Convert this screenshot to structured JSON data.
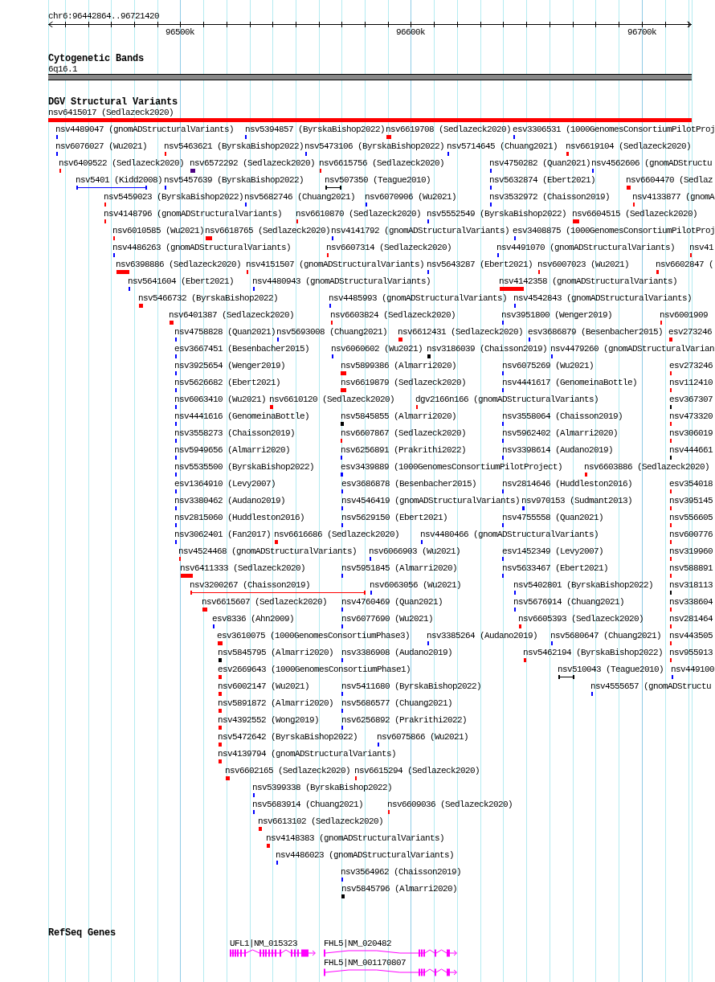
{
  "ruler": {
    "position": "chr6:96442864..96721420",
    "ticks": [
      "96500k",
      "96600k",
      "96700k"
    ]
  },
  "cytogenetic_bands": {
    "title": "Cytogenetic Bands",
    "band_label": "6q16.1"
  },
  "dgv_structural_variants": {
    "title": "DGV Structural Variants",
    "rows": [
      {
        "features": [
          {
            "label": "nsv6415017 (Sedlazeck2020)",
            "color": "#ff0000",
            "kind": "block"
          }
        ]
      },
      {
        "features": [
          {
            "label": "nsv4489047 (gnomADStructuralVariants)",
            "color": "#0000ff",
            "kind": "block"
          },
          {
            "label": "nsv5394857 (ByrskaBishop2022)",
            "color": "#0000ff",
            "kind": "block"
          },
          {
            "label": "nsv6619708 (Sedlazeck2020)",
            "color": "#ff0000",
            "kind": "block"
          },
          {
            "label": "esv3306531 (1000GenomesConsortiumPilotProj",
            "color": "#0000ff",
            "kind": "block"
          }
        ]
      },
      {
        "features": [
          {
            "label": "nsv6076027 (Wu2021)",
            "color": "#0000ff",
            "kind": "block"
          },
          {
            "label": "nsv5463621 (ByrskaBishop2022)",
            "color": "#ff0000",
            "kind": "block"
          },
          {
            "label": "nsv5473106 (ByrskaBishop2022)",
            "color": "#0000ff",
            "kind": "block"
          },
          {
            "label": "nsv5714645 (Chuang2021)",
            "color": "#0000ff",
            "kind": "block"
          },
          {
            "label": "nsv6619104 (Sedlazeck2020)",
            "color": "#ff0000",
            "kind": "block"
          }
        ]
      },
      {
        "features": [
          {
            "label": "nsv6409522 (Sedlazeck2020)",
            "color": "#ff0000",
            "kind": "block"
          },
          {
            "label": "nsv6572292 (Sedlazeck2020)",
            "color": "#4b0082",
            "kind": "block"
          },
          {
            "label": "nsv6615756 (Sedlazeck2020)",
            "color": "#ff0000",
            "kind": "block"
          },
          {
            "label": "nsv4750282 (Quan2021)",
            "color": "#0000ff",
            "kind": "block"
          },
          {
            "label": "nsv4562606 (gnomADStructu",
            "color": "#0000ff",
            "kind": "block"
          }
        ]
      },
      {
        "features": [
          {
            "label": "nsv5401 (Kidd2008)",
            "color": "#0000ff",
            "kind": "span"
          },
          {
            "label": "nsv5457639 (ByrskaBishop2022)",
            "color": "#0000ff",
            "kind": "block"
          },
          {
            "label": "nsv507350 (Teague2010)",
            "color": "#000000",
            "kind": "span"
          },
          {
            "label": "nsv5632874 (Ebert2021)",
            "color": "#0000ff",
            "kind": "block"
          },
          {
            "label": "nsv6604470 (Sedlaz",
            "color": "#ff0000",
            "kind": "block"
          }
        ]
      },
      {
        "features": [
          {
            "label": "nsv5459023 (ByrskaBishop2022)",
            "color": "#ff0000",
            "kind": "block"
          },
          {
            "label": "nsv5682746 (Chuang2021)",
            "color": "#0000ff",
            "kind": "block"
          },
          {
            "label": "nsv6070906 (Wu2021)",
            "color": "#0000ff",
            "kind": "block"
          },
          {
            "label": "nsv3532972 (Chaisson2019)",
            "color": "#0000ff",
            "kind": "block"
          },
          {
            "label": "nsv4133877 (gnomA",
            "color": "#ff0000",
            "kind": "block"
          }
        ]
      },
      {
        "features": [
          {
            "label": "nsv4148796 (gnomADStructuralVariants)",
            "color": "#ff0000",
            "kind": "block"
          },
          {
            "label": "nsv6610870 (Sedlazeck2020)",
            "color": "#ff0000",
            "kind": "block"
          },
          {
            "label": "nsv5552549 (ByrskaBishop2022)",
            "color": "#0000ff",
            "kind": "block"
          },
          {
            "label": "nsv6604515 (Sedlazeck2020)",
            "color": "#ff0000",
            "kind": "block"
          }
        ]
      },
      {
        "features": [
          {
            "label": "nsv6010585 (Wu2021)",
            "color": "#ff0000",
            "kind": "block"
          },
          {
            "label": "nsv6618765 (Sedlazeck2020)",
            "color": "#ff0000",
            "kind": "block"
          },
          {
            "label": "nsv4141792 (gnomADStructuralVariants)",
            "color": "#0000ff",
            "kind": "block"
          },
          {
            "label": "esv3408875 (1000GenomesConsortiumPilotProj",
            "color": "#0000ff",
            "kind": "block"
          }
        ]
      },
      {
        "features": [
          {
            "label": "nsv4486263 (gnomADStructuralVariants)",
            "color": "#0000ff",
            "kind": "block"
          },
          {
            "label": "nsv6607314 (Sedlazeck2020)",
            "color": "#ff0000",
            "kind": "block"
          },
          {
            "label": "nsv4491070 (gnomADStructuralVariants)",
            "color": "#0000ff",
            "kind": "block"
          },
          {
            "label": "nsv41",
            "color": "#ff0000",
            "kind": "block"
          }
        ]
      },
      {
        "features": [
          {
            "label": "nsv6398886 (Sedlazeck2020)",
            "color": "#ff0000",
            "kind": "block"
          },
          {
            "label": "nsv4151507 (gnomADStructuralVariants)",
            "color": "#ff0000",
            "kind": "block"
          },
          {
            "label": "nsv5643287 (Ebert2021)",
            "color": "#0000ff",
            "kind": "block"
          },
          {
            "label": "nsv6007023 (Wu2021)",
            "color": "#ff0000",
            "kind": "block"
          },
          {
            "label": "nsv6602847 (",
            "color": "#ff0000",
            "kind": "block"
          }
        ]
      },
      {
        "features": [
          {
            "label": "nsv5641604 (Ebert2021)",
            "color": "#0000ff",
            "kind": "block"
          },
          {
            "label": "nsv4480943 (gnomADStructuralVariants)",
            "color": "#0000ff",
            "kind": "block"
          },
          {
            "label": "nsv4142358 (gnomADStructuralVariants)",
            "color": "#ff0000",
            "kind": "block"
          }
        ]
      },
      {
        "features": [
          {
            "label": "nsv5466732 (ByrskaBishop2022)",
            "color": "#ff0000",
            "kind": "block"
          },
          {
            "label": "nsv4485993 (gnomADStructuralVariants)",
            "color": "#0000ff",
            "kind": "block"
          },
          {
            "label": "nsv4542843 (gnomADStructuralVariants)",
            "color": "#0000ff",
            "kind": "block"
          }
        ]
      },
      {
        "features": [
          {
            "label": "nsv6401387 (Sedlazeck2020)",
            "color": "#ff0000",
            "kind": "block"
          },
          {
            "label": "nsv6603824 (Sedlazeck2020)",
            "color": "#ff0000",
            "kind": "block"
          },
          {
            "label": "nsv3951800 (Wenger2019)",
            "color": "#0000ff",
            "kind": "block"
          },
          {
            "label": "nsv6001909",
            "color": "#ff0000",
            "kind": "block"
          }
        ]
      },
      {
        "features": [
          {
            "label": "nsv4758828 (Quan2021)",
            "color": "#0000ff",
            "kind": "block"
          },
          {
            "label": "nsv5693008 (Chuang2021)",
            "color": "#0000ff",
            "kind": "block"
          },
          {
            "label": "nsv6612431 (Sedlazeck2020)",
            "color": "#ff0000",
            "kind": "block"
          },
          {
            "label": "esv3686879 (Besenbacher2015)",
            "color": "#0000ff",
            "kind": "block"
          },
          {
            "label": "esv273246",
            "color": "#ff0000",
            "kind": "block"
          }
        ]
      },
      {
        "features": [
          {
            "label": "esv3667451 (Besenbacher2015)",
            "color": "#0000ff",
            "kind": "block"
          },
          {
            "label": "nsv6060602 (Wu2021)",
            "color": "#0000ff",
            "kind": "block"
          },
          {
            "label": "nsv3186039 (Chaisson2019)",
            "color": "#000000",
            "kind": "block"
          },
          {
            "label": "nsv4479260 (gnomADStructuralVarian",
            "color": "#0000ff",
            "kind": "block"
          }
        ]
      },
      {
        "features": [
          {
            "label": "nsv3925654 (Wenger2019)",
            "color": "#0000ff",
            "kind": "block"
          },
          {
            "label": "nsv5899386 (Almarri2020)",
            "color": "#ff0000",
            "kind": "block"
          },
          {
            "label": "nsv6075269 (Wu2021)",
            "color": "#0000ff",
            "kind": "block"
          },
          {
            "label": "esv273246",
            "color": "#ff0000",
            "kind": "block"
          }
        ]
      },
      {
        "features": [
          {
            "label": "nsv5626682 (Ebert2021)",
            "color": "#0000ff",
            "kind": "block"
          },
          {
            "label": "nsv6619879 (Sedlazeck2020)",
            "color": "#ff0000",
            "kind": "block"
          },
          {
            "label": "nsv4441617 (GenomeinaBottle)",
            "color": "#0000ff",
            "kind": "block"
          },
          {
            "label": "nsv112410",
            "color": "#ff0000",
            "kind": "block"
          }
        ]
      },
      {
        "features": [
          {
            "label": "nsv6063410 (Wu2021)",
            "color": "#0000ff",
            "kind": "block"
          },
          {
            "label": "nsv6610120 (Sedlazeck2020)",
            "color": "#ff0000",
            "kind": "block"
          },
          {
            "label": "dgv2166n166 (gnomADStructuralVariants)",
            "color": "#ff0000",
            "kind": "block"
          },
          {
            "label": "esv367307",
            "color": "#000000",
            "kind": "block"
          }
        ]
      },
      {
        "features": [
          {
            "label": "nsv4441616 (GenomeinaBottle)",
            "color": "#0000ff",
            "kind": "block"
          },
          {
            "label": "nsv5845855 (Almarri2020)",
            "color": "#000000",
            "kind": "block"
          },
          {
            "label": "nsv3558064 (Chaisson2019)",
            "color": "#0000ff",
            "kind": "block"
          },
          {
            "label": "nsv473320",
            "color": "#ff0000",
            "kind": "block"
          }
        ]
      },
      {
        "features": [
          {
            "label": "nsv3558273 (Chaisson2019)",
            "color": "#0000ff",
            "kind": "block"
          },
          {
            "label": "nsv6607867 (Sedlazeck2020)",
            "color": "#ff0000",
            "kind": "block"
          },
          {
            "label": "nsv5962402 (Almarri2020)",
            "color": "#0000ff",
            "kind": "block"
          },
          {
            "label": "nsv306019",
            "color": "#ff0000",
            "kind": "block"
          }
        ]
      },
      {
        "features": [
          {
            "label": "nsv5949656 (Almarri2020)",
            "color": "#0000ff",
            "kind": "block"
          },
          {
            "label": "nsv6256891 (Prakrithi2022)",
            "color": "#0000ff",
            "kind": "block"
          },
          {
            "label": "nsv3398614 (Audano2019)",
            "color": "#0000ff",
            "kind": "block"
          },
          {
            "label": "nsv444661",
            "color": "#000000",
            "kind": "block"
          }
        ]
      },
      {
        "features": [
          {
            "label": "nsv5535500 (ByrskaBishop2022)",
            "color": "#0000ff",
            "kind": "block"
          },
          {
            "label": "esv3439889 (1000GenomesConsortiumPilotProject)",
            "color": "#0000ff",
            "kind": "block"
          },
          {
            "label": "nsv6603886 (Sedlazeck2020)",
            "color": "#ff0000",
            "kind": "block"
          }
        ]
      },
      {
        "features": [
          {
            "label": "esv1364910 (Levy2007)",
            "color": "#0000ff",
            "kind": "block"
          },
          {
            "label": "esv3686878 (Besenbacher2015)",
            "color": "#0000ff",
            "kind": "block"
          },
          {
            "label": "nsv2814646 (Huddleston2016)",
            "color": "#0000ff",
            "kind": "block"
          },
          {
            "label": "esv354018",
            "color": "#ff0000",
            "kind": "block"
          }
        ]
      },
      {
        "features": [
          {
            "label": "nsv3380462 (Audano2019)",
            "color": "#0000ff",
            "kind": "block"
          },
          {
            "label": "nsv4546419 (gnomADStructuralVariants)",
            "color": "#0000ff",
            "kind": "block"
          },
          {
            "label": "nsv970153 (Sudmant2013)",
            "color": "#0000ff",
            "kind": "block"
          },
          {
            "label": "nsv395145",
            "color": "#ff0000",
            "kind": "block"
          }
        ]
      },
      {
        "features": [
          {
            "label": "nsv2815060 (Huddleston2016)",
            "color": "#0000ff",
            "kind": "block"
          },
          {
            "label": "nsv5629150 (Ebert2021)",
            "color": "#0000ff",
            "kind": "block"
          },
          {
            "label": "nsv4755558 (Quan2021)",
            "color": "#0000ff",
            "kind": "block"
          },
          {
            "label": "nsv556605",
            "color": "#ff0000",
            "kind": "block"
          }
        ]
      },
      {
        "features": [
          {
            "label": "nsv3062401 (Fan2017)",
            "color": "#0000ff",
            "kind": "block"
          },
          {
            "label": "nsv6616686 (Sedlazeck2020)",
            "color": "#ff0000",
            "kind": "block"
          },
          {
            "label": "nsv4480466 (gnomADStructuralVariants)",
            "color": "#0000ff",
            "kind": "block"
          },
          {
            "label": "nsv600776",
            "color": "#ff0000",
            "kind": "block"
          }
        ]
      },
      {
        "features": [
          {
            "label": "nsv4524468 (gnomADStructuralVariants)",
            "color": "#ff0000",
            "kind": "block"
          },
          {
            "label": "nsv6066903 (Wu2021)",
            "color": "#0000ff",
            "kind": "block"
          },
          {
            "label": "esv1452349 (Levy2007)",
            "color": "#0000ff",
            "kind": "block"
          },
          {
            "label": "nsv319960",
            "color": "#ff0000",
            "kind": "block"
          }
        ]
      },
      {
        "features": [
          {
            "label": "nsv6411333 (Sedlazeck2020)",
            "color": "#ff0000",
            "kind": "block"
          },
          {
            "label": "nsv5951845 (Almarri2020)",
            "color": "#0000ff",
            "kind": "block"
          },
          {
            "label": "nsv5633467 (Ebert2021)",
            "color": "#0000ff",
            "kind": "block"
          },
          {
            "label": "nsv588891",
            "color": "#ff0000",
            "kind": "block"
          }
        ]
      },
      {
        "features": [
          {
            "label": "nsv3200267 (Chaisson2019)",
            "color": "#ff0000",
            "kind": "span"
          },
          {
            "label": "nsv6063056 (Wu2021)",
            "color": "#0000ff",
            "kind": "block"
          },
          {
            "label": "nsv5402801 (ByrskaBishop2022)",
            "color": "#0000ff",
            "kind": "block"
          },
          {
            "label": "nsv318113",
            "color": "#000000",
            "kind": "block"
          }
        ]
      },
      {
        "features": [
          {
            "label": "nsv6615607 (Sedlazeck2020)",
            "color": "#ff0000",
            "kind": "block"
          },
          {
            "label": "nsv4760469 (Quan2021)",
            "color": "#0000ff",
            "kind": "block"
          },
          {
            "label": "nsv5676914 (Chuang2021)",
            "color": "#0000ff",
            "kind": "block"
          },
          {
            "label": "nsv338604",
            "color": "#ff0000",
            "kind": "block"
          }
        ]
      },
      {
        "features": [
          {
            "label": "esv8336 (Ahn2009)",
            "color": "#0000ff",
            "kind": "block"
          },
          {
            "label": "nsv6077690 (Wu2021)",
            "color": "#0000ff",
            "kind": "block"
          },
          {
            "label": "nsv6605393 (Sedlazeck2020)",
            "color": "#ff0000",
            "kind": "block"
          },
          {
            "label": "nsv281464",
            "color": "#ff0000",
            "kind": "block"
          }
        ]
      },
      {
        "features": [
          {
            "label": "esv3610075 (1000GenomesConsortiumPhase3)",
            "color": "#ff0000",
            "kind": "block"
          },
          {
            "label": "nsv3385264 (Audano2019)",
            "color": "#0000ff",
            "kind": "block"
          },
          {
            "label": "nsv5680647 (Chuang2021)",
            "color": "#0000ff",
            "kind": "block"
          },
          {
            "label": "nsv443505",
            "color": "#ff0000",
            "kind": "block"
          }
        ]
      },
      {
        "features": [
          {
            "label": "nsv5845795 (Almarri2020)",
            "color": "#000000",
            "kind": "block"
          },
          {
            "label": "nsv3386908 (Audano2019)",
            "color": "#0000ff",
            "kind": "block"
          },
          {
            "label": "nsv5462194 (ByrskaBishop2022)",
            "color": "#ff0000",
            "kind": "block"
          },
          {
            "label": "nsv955913",
            "color": "#ff0000",
            "kind": "block"
          }
        ]
      },
      {
        "features": [
          {
            "label": "esv2669643 (1000GenomesConsortiumPhase1)",
            "color": "#ff0000",
            "kind": "block"
          },
          {
            "label": "nsv510043 (Teague2010)",
            "color": "#000000",
            "kind": "span"
          },
          {
            "label": "nsv449100",
            "color": "#0000ff",
            "kind": "block"
          }
        ]
      },
      {
        "features": [
          {
            "label": "nsv6002147 (Wu2021)",
            "color": "#ff0000",
            "kind": "block"
          },
          {
            "label": "nsv5411680 (ByrskaBishop2022)",
            "color": "#0000ff",
            "kind": "block"
          },
          {
            "label": "nsv4555657 (gnomADStructu",
            "color": "#0000ff",
            "kind": "block"
          }
        ]
      },
      {
        "features": [
          {
            "label": "nsv5891872 (Almarri2020)",
            "color": "#ff0000",
            "kind": "block"
          },
          {
            "label": "nsv5686577 (Chuang2021)",
            "color": "#0000ff",
            "kind": "block"
          }
        ]
      },
      {
        "features": [
          {
            "label": "nsv4392552 (Wong2019)",
            "color": "#ff0000",
            "kind": "block"
          },
          {
            "label": "nsv6256892 (Prakrithi2022)",
            "color": "#0000ff",
            "kind": "block"
          }
        ]
      },
      {
        "features": [
          {
            "label": "nsv5472642 (ByrskaBishop2022)",
            "color": "#ff0000",
            "kind": "block"
          },
          {
            "label": "nsv6075866 (Wu2021)",
            "color": "#0000ff",
            "kind": "block"
          }
        ]
      },
      {
        "features": [
          {
            "label": "nsv4139794 (gnomADStructuralVariants)",
            "color": "#ff0000",
            "kind": "block"
          }
        ]
      },
      {
        "features": [
          {
            "label": "nsv6602165 (Sedlazeck2020)",
            "color": "#ff0000",
            "kind": "block"
          },
          {
            "label": "nsv6615294 (Sedlazeck2020)",
            "color": "#ff0000",
            "kind": "block"
          }
        ]
      },
      {
        "features": [
          {
            "label": "nsv5399338 (ByrskaBishop2022)",
            "color": "#0000ff",
            "kind": "block"
          }
        ]
      },
      {
        "features": [
          {
            "label": "nsv5683914 (Chuang2021)",
            "color": "#0000ff",
            "kind": "block"
          },
          {
            "label": "nsv6609036 (Sedlazeck2020)",
            "color": "#ff0000",
            "kind": "block"
          }
        ]
      },
      {
        "features": [
          {
            "label": "nsv6613102 (Sedlazeck2020)",
            "color": "#ff0000",
            "kind": "block"
          }
        ]
      },
      {
        "features": [
          {
            "label": "nsv4148383 (gnomADStructuralVariants)",
            "color": "#ff0000",
            "kind": "block"
          }
        ]
      },
      {
        "features": [
          {
            "label": "nsv4486023 (gnomADStructuralVariants)",
            "color": "#0000ff",
            "kind": "block"
          }
        ]
      },
      {
        "features": [
          {
            "label": "nsv3564962 (Chaisson2019)",
            "color": "#0000ff",
            "kind": "block"
          }
        ]
      },
      {
        "features": [
          {
            "label": "nsv5845796 (Almarri2020)",
            "color": "#000000",
            "kind": "block"
          }
        ]
      }
    ]
  },
  "refseq_genes": {
    "title": "RefSeq Genes",
    "rows": [
      {
        "genes": [
          {
            "label": "UFL1|NM_015323"
          },
          {
            "label": "FHL5|NM_020482"
          }
        ]
      },
      {
        "genes": [
          {
            "label": "FHL5|NM_001170807"
          }
        ]
      }
    ]
  }
}
